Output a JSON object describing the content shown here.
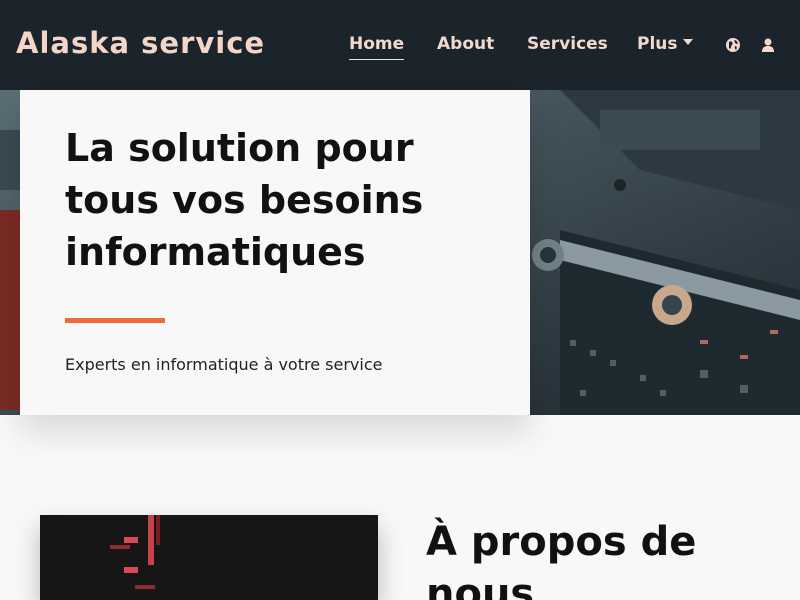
{
  "header": {
    "brand": "Alaska service",
    "nav": [
      {
        "label": "Home"
      },
      {
        "label": "About"
      },
      {
        "label": "Services"
      },
      {
        "label": "Plus"
      }
    ],
    "icons": [
      "globe-icon",
      "user-icon"
    ]
  },
  "hero": {
    "title": "La solution pour tous vos besoins informatiques",
    "subtitle": "Experts en informatique à votre service",
    "accent_color": "#ef6a3a"
  },
  "about": {
    "title": "À propos de nous"
  },
  "colors": {
    "navbar": "#1b232b",
    "nav_text": "#f2d9cc",
    "brand_text": "#f4d6c8",
    "page_bg": "#f8f8f8"
  }
}
